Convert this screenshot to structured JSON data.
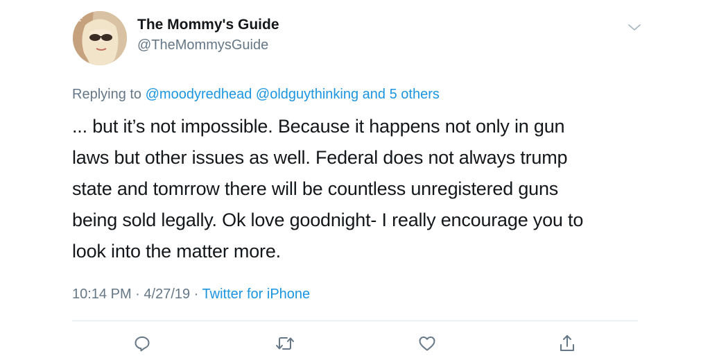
{
  "author": {
    "display_name": "The Mommy's Guide",
    "handle": "@TheMommysGuide"
  },
  "reply": {
    "prefix": "Replying to ",
    "mention_1": "@moodyredhead",
    "mention_2": "@oldguythinking",
    "others": "and 5 others"
  },
  "body": {
    "lines": [
      "... but it’s not impossible. Because it happens not only in gun",
      "laws but other issues as well. Federal does not always trump",
      "state and tomrrow there will be countless unregistered guns",
      "being sold legally. Ok love goodnight- I really encourage you to",
      "look into the matter more."
    ]
  },
  "meta": {
    "time": "10:14 PM",
    "sep1": " · ",
    "date": "4/27/19",
    "sep2": " · ",
    "source": "Twitter for iPhone"
  },
  "icons": {
    "caret": "chevron-down-icon",
    "reply": "reply-icon",
    "retweet": "retweet-icon",
    "like": "heart-icon",
    "share": "share-icon"
  },
  "colors": {
    "link": "#1b95e0",
    "secondary_text": "#657786",
    "primary_text": "#14171a",
    "icon": "#657786",
    "divider": "#e1e8ed"
  }
}
